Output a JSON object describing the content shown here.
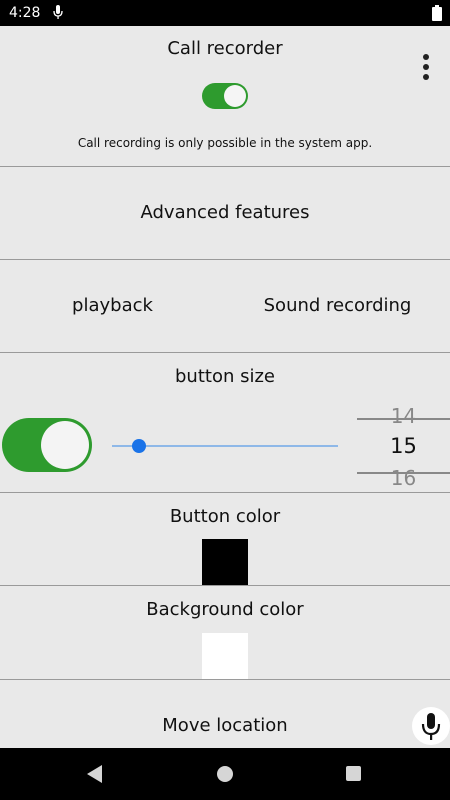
{
  "status_bar": {
    "time": "4:28"
  },
  "call_recorder": {
    "title": "Call recorder",
    "toggle_on": true,
    "note": "Call recording is only possible in the system app."
  },
  "advanced": {
    "label": "Advanced features"
  },
  "playback_row": {
    "left": "playback",
    "right": "Sound recording"
  },
  "button_size": {
    "title": "button size",
    "toggle_on": true,
    "slider_fraction": 0.12,
    "picker": {
      "prev": "14",
      "current": "15",
      "next": "16"
    }
  },
  "button_color": {
    "title": "Button color",
    "color": "#000000"
  },
  "background_color": {
    "title": "Background color",
    "color": "#ffffff"
  },
  "move_location": {
    "label": "Move location"
  },
  "colors": {
    "accent_green": "#2e9b2e",
    "slider_blue": "#1a73e8"
  }
}
